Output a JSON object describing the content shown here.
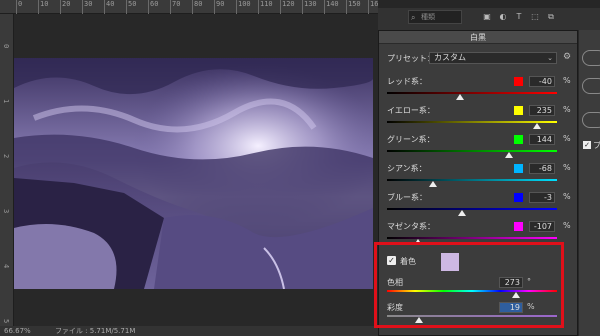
{
  "window": {
    "dialog_title": "白黒"
  },
  "ruler": {
    "top_ticks": [
      "0",
      "10",
      "20",
      "30",
      "40",
      "50",
      "60",
      "70",
      "80",
      "90",
      "100",
      "110",
      "120",
      "130",
      "140",
      "150",
      "160"
    ],
    "left_ticks": [
      "0",
      "1",
      "2",
      "3",
      "4",
      "5"
    ]
  },
  "status": {
    "zoom": "66.67%",
    "doc_info": "ファイル : 5.71M/5.71M"
  },
  "search": {
    "placeholder": "種類"
  },
  "preset": {
    "label": "プリセット：",
    "value": "カスタム"
  },
  "sliders": [
    {
      "label": "レッド系：",
      "value": "-40",
      "unit": "%",
      "color": "#ff0000",
      "gradient": "linear-gradient(90deg,#000,#ff0000)",
      "level": 0.432
    },
    {
      "label": "イエロー系：",
      "value": "235",
      "unit": "%",
      "color": "#ffff00",
      "gradient": "linear-gradient(90deg,#000,#ffff00)",
      "level": 0.88
    },
    {
      "label": "グリーン系：",
      "value": "144",
      "unit": "%",
      "color": "#00ff00",
      "gradient": "linear-gradient(90deg,#000,#00ff00)",
      "level": 0.72
    },
    {
      "label": "シアン系：",
      "value": "-68",
      "unit": "%",
      "color": "#00b4ff",
      "gradient": "linear-gradient(90deg,#000,#00e0ff)",
      "level": 0.27
    },
    {
      "label": "ブルー系：",
      "value": "-3",
      "unit": "%",
      "color": "#0000ff",
      "gradient": "linear-gradient(90deg,#000,#0000ff)",
      "level": 0.44
    },
    {
      "label": "マゼンタ系：",
      "value": "-107",
      "unit": "%",
      "color": "#ff00ff",
      "gradient": "linear-gradient(90deg,#000,#ff00ff)",
      "level": 0.185
    }
  ],
  "tint": {
    "label": "着色",
    "checked": true,
    "color": "#cdb8e3"
  },
  "hue": {
    "label": "色相",
    "value": "273",
    "unit": "°",
    "level": 0.76
  },
  "saturation": {
    "label": "彩度",
    "value": "19",
    "unit": "%",
    "level": 0.19
  },
  "right_panel": {
    "preview_label": "プ",
    "preview_checked": true
  }
}
